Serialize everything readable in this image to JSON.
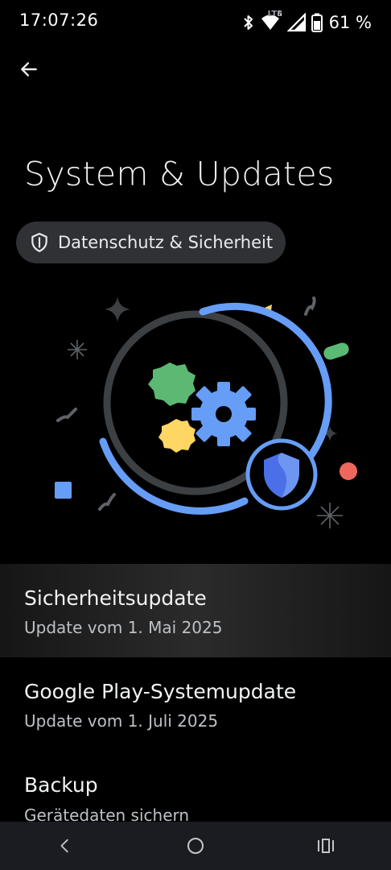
{
  "status_bar": {
    "time": "17:07:26",
    "network_badge": "LTE",
    "wifi_badge": "6",
    "battery_percent": "61 %",
    "icons": [
      "bluetooth-icon",
      "wifi-icon",
      "signal-icon",
      "battery-icon"
    ]
  },
  "header": {
    "back_icon": "arrow-left-icon",
    "title": "System & Updates"
  },
  "chip": {
    "icon": "shield-icon",
    "label": "Datenschutz & Sicherheit"
  },
  "list": [
    {
      "title": "Sicherheitsupdate",
      "subtitle": "Update vom 1. Mai 2025"
    },
    {
      "title": "Google Play-Systemupdate",
      "subtitle": "Update vom 1. Juli 2025"
    },
    {
      "title": "Backup",
      "subtitle": "Gerätedaten sichern"
    }
  ],
  "nav": {
    "icons": [
      "back-icon",
      "home-icon",
      "recents-icon"
    ]
  },
  "colors": {
    "background": "#000000",
    "accent_blue": "#669df6",
    "green": "#5bb974",
    "yellow": "#fdd663",
    "red": "#ee675c",
    "chip_bg": "#303134"
  }
}
